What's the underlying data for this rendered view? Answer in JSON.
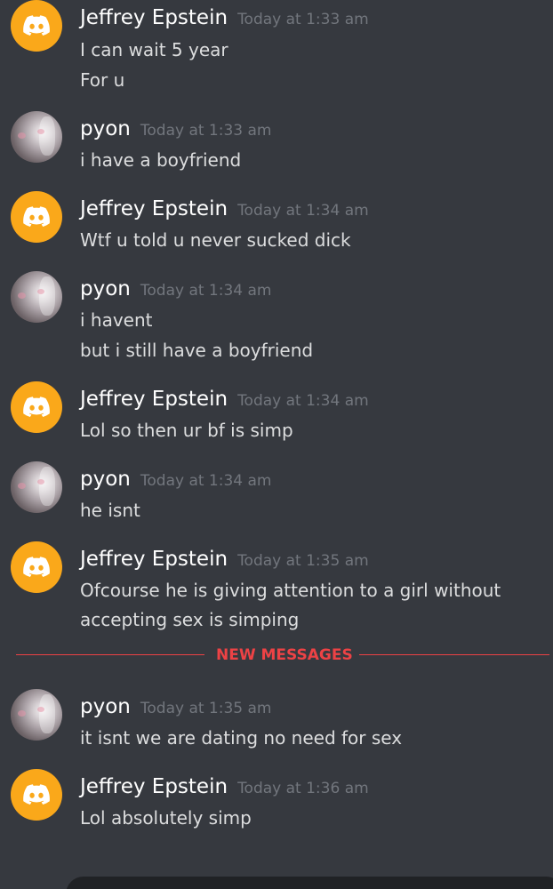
{
  "colors": {
    "background": "#36393f",
    "username": "#ffffff",
    "timestamp": "#72767d",
    "message_text": "#dcddde",
    "new_messages_red": "#ed4245",
    "discord_avatar_orange": "#faa81a"
  },
  "messages": [
    {
      "author": "Jeffrey Epstein",
      "timestamp": "Today at 1:33 am",
      "avatar": "discord-logo-icon",
      "lines": [
        "I can wait  5 year",
        "For u"
      ]
    },
    {
      "author": "pyon",
      "timestamp": "Today at 1:33 am",
      "avatar": "user-photo-avatar",
      "lines": [
        "i have a boyfriend"
      ]
    },
    {
      "author": "Jeffrey Epstein",
      "timestamp": "Today at 1:34 am",
      "avatar": "discord-logo-icon",
      "lines": [
        "Wtf u told u never sucked dick"
      ]
    },
    {
      "author": "pyon",
      "timestamp": "Today at 1:34 am",
      "avatar": "user-photo-avatar",
      "lines": [
        "i havent",
        "but i still have a boyfriend"
      ]
    },
    {
      "author": "Jeffrey Epstein",
      "timestamp": "Today at 1:34 am",
      "avatar": "discord-logo-icon",
      "lines": [
        "Lol so then ur bf is simp"
      ]
    },
    {
      "author": "pyon",
      "timestamp": "Today at 1:34 am",
      "avatar": "user-photo-avatar",
      "lines": [
        "he isnt"
      ]
    },
    {
      "author": "Jeffrey Epstein",
      "timestamp": "Today at 1:35 am",
      "avatar": "discord-logo-icon",
      "lines": [
        "Ofcourse he is giving  attention to a girl without",
        "accepting sex  is simping"
      ]
    },
    {
      "author": "pyon",
      "timestamp": "Today at 1:35 am",
      "avatar": "user-photo-avatar",
      "lines": [
        "it isnt we are dating no need for sex"
      ]
    },
    {
      "author": "Jeffrey Epstein",
      "timestamp": "Today at 1:36 am",
      "avatar": "discord-logo-icon",
      "lines": [
        "Lol absolutely simp"
      ]
    }
  ],
  "new_messages_divider": {
    "label": "NEW MESSAGES"
  }
}
